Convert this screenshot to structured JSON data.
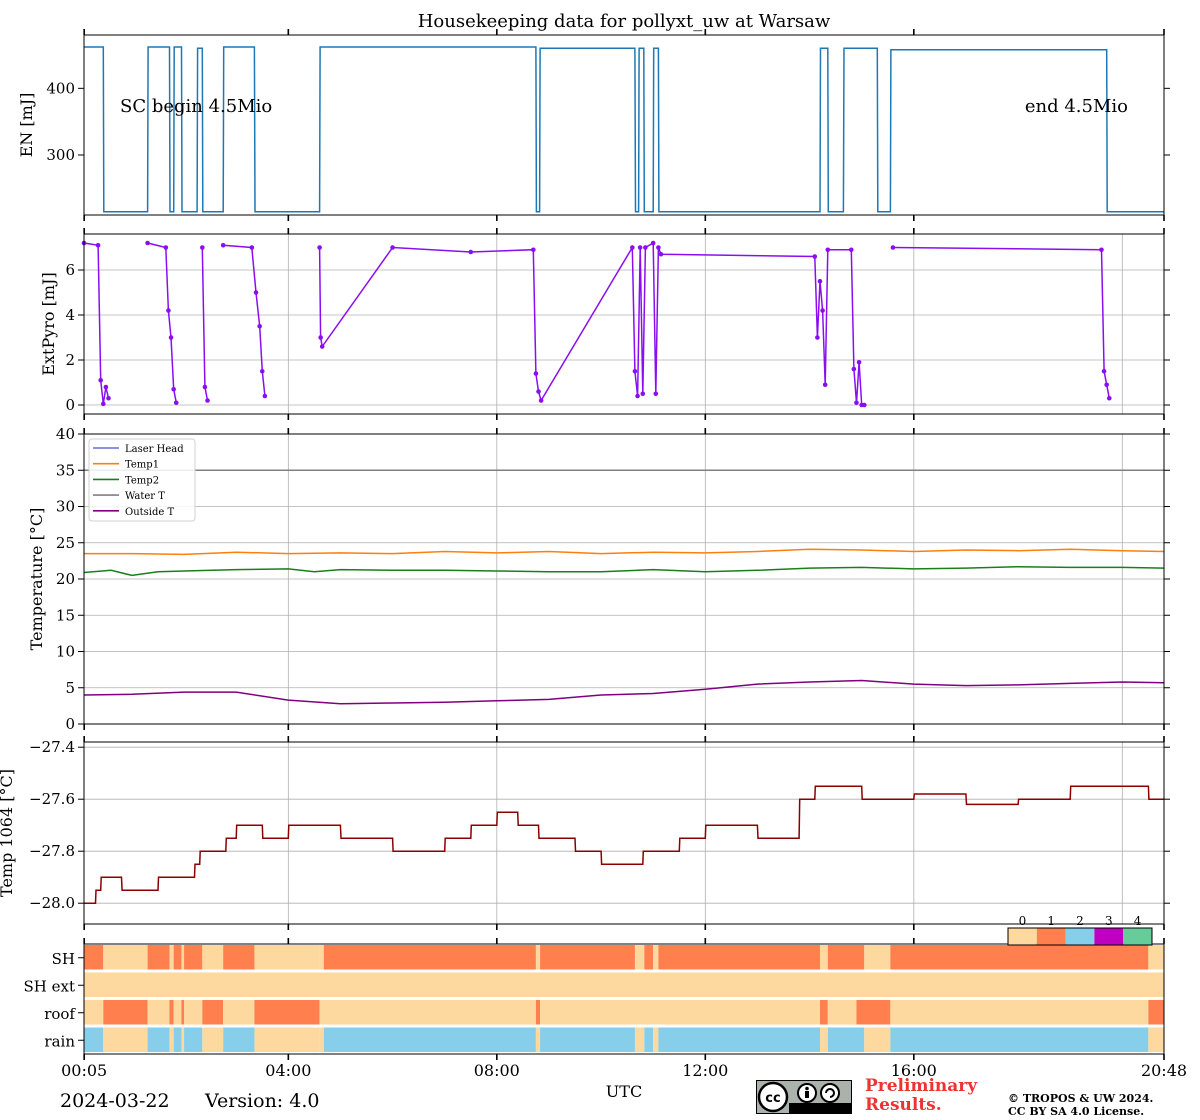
{
  "chart_data": [
    {
      "panel": "EN",
      "type": "line",
      "title": "Housekeeping data for pollyxt_uw at Warsaw",
      "ylabel": "EN [mJ]",
      "ylim": [
        210,
        480
      ],
      "yticks": [
        300,
        400
      ],
      "color": "#1f77b4",
      "annotations": [
        "SC begin 4.5Mio",
        "end 4.5Mio"
      ],
      "series": [
        {
          "x": [
            0.08,
            0.45,
            0.46,
            1.3,
            1.31,
            1.72,
            1.73,
            1.8,
            1.81,
            1.95,
            1.96,
            2.25,
            2.26,
            2.35,
            2.36,
            2.75,
            2.76,
            3.35,
            3.36,
            4.6,
            4.61,
            8.75,
            8.76,
            8.82,
            8.83,
            10.65,
            10.66,
            10.72,
            10.73,
            10.82,
            10.83,
            11.0,
            11.01,
            11.1,
            11.11,
            14.2,
            14.21,
            14.35,
            14.36,
            14.65,
            14.66,
            15.3,
            15.31,
            15.55,
            15.56,
            19.7,
            19.71,
            20.8
          ],
          "y": [
            462,
            462,
            215,
            215,
            462,
            462,
            215,
            215,
            462,
            462,
            215,
            215,
            460,
            460,
            215,
            215,
            462,
            462,
            215,
            215,
            462,
            462,
            215,
            215,
            460,
            460,
            215,
            215,
            460,
            460,
            215,
            215,
            460,
            460,
            215,
            215,
            460,
            460,
            215,
            215,
            460,
            460,
            215,
            215,
            458,
            458,
            215,
            215
          ]
        }
      ]
    },
    {
      "panel": "ExtPyro",
      "type": "line",
      "ylabel": "ExtPyro [mJ]",
      "ylim": [
        -0.4,
        7.6
      ],
      "yticks": [
        0,
        2,
        4,
        6
      ],
      "color": "#8a0ef0",
      "series": [
        {
          "x": [
            0.08,
            0.35,
            0.4,
            0.45,
            0.5,
            0.55,
            0.6,
            null,
            1.3,
            1.65,
            1.7,
            1.75,
            1.8,
            1.85,
            1.9,
            2.35,
            2.4,
            2.45,
            null,
            2.75,
            3.3,
            3.38,
            3.45,
            3.5,
            3.55,
            null,
            4.6,
            4.62,
            4.65,
            6.0,
            7.5,
            8.7,
            8.75,
            8.8,
            8.85,
            10.6,
            10.65,
            10.7,
            10.75,
            10.8,
            10.85,
            11.0,
            11.05,
            11.1,
            11.15,
            14.1,
            14.15,
            14.2,
            14.25,
            14.3,
            14.35,
            14.8,
            14.85,
            14.9,
            14.95,
            15.0,
            15.05,
            null,
            15.6,
            19.6,
            19.65,
            19.7,
            19.75
          ],
          "y": [
            7.2,
            7.1,
            1.1,
            0.05,
            0.8,
            0.3,
            null,
            null,
            7.2,
            7.0,
            4.2,
            3.0,
            0.7,
            0.1,
            null,
            7.0,
            0.8,
            0.2,
            null,
            7.1,
            7.0,
            5.0,
            3.5,
            1.5,
            0.4,
            null,
            7.0,
            3.0,
            2.6,
            7.0,
            6.8,
            6.9,
            1.4,
            0.6,
            0.2,
            7.0,
            1.5,
            0.4,
            7.0,
            0.5,
            7.0,
            7.2,
            0.5,
            7.0,
            6.7,
            6.6,
            3.0,
            5.5,
            4.2,
            0.9,
            6.9,
            6.9,
            1.6,
            0.1,
            1.9,
            0.0,
            0.0,
            null,
            7.0,
            6.9,
            1.5,
            0.9,
            0.3
          ]
        }
      ]
    },
    {
      "panel": "Temperature",
      "type": "line",
      "ylabel": "Temperature [$^\\circ C$]",
      "ylim": [
        0,
        40
      ],
      "yticks": [
        0,
        5,
        10,
        15,
        20,
        25,
        30,
        35,
        40
      ],
      "legend_loc": "upper-left",
      "series": [
        {
          "name": "Laser Head",
          "color": "#6b6bd6",
          "x": [],
          "y": []
        },
        {
          "name": "Temp1",
          "color": "#ff7f0e",
          "x": [
            0.08,
            1.0,
            2.0,
            3.0,
            4.0,
            5.0,
            6.0,
            7.0,
            8.0,
            9.0,
            10.0,
            11.0,
            12.0,
            13.0,
            14.0,
            15.0,
            16.0,
            17.0,
            18.0,
            19.0,
            20.0,
            20.8
          ],
          "y": [
            23.5,
            23.5,
            23.4,
            23.7,
            23.5,
            23.6,
            23.5,
            23.8,
            23.6,
            23.8,
            23.5,
            23.7,
            23.6,
            23.8,
            24.1,
            24.0,
            23.8,
            24.0,
            23.9,
            24.1,
            23.9,
            23.8
          ]
        },
        {
          "name": "Temp2",
          "color": "#1a7f1a",
          "x": [
            0.08,
            0.6,
            1.0,
            1.5,
            2.0,
            3.0,
            4.0,
            4.5,
            5.0,
            6.0,
            7.0,
            8.0,
            9.0,
            10.0,
            11.0,
            12.0,
            13.0,
            14.0,
            15.0,
            16.0,
            17.0,
            18.0,
            19.0,
            20.0,
            20.8
          ],
          "y": [
            20.9,
            21.2,
            20.5,
            21.0,
            21.1,
            21.3,
            21.4,
            21.0,
            21.3,
            21.2,
            21.2,
            21.1,
            21.0,
            21.0,
            21.3,
            21.0,
            21.2,
            21.5,
            21.6,
            21.4,
            21.5,
            21.7,
            21.6,
            21.6,
            21.5
          ]
        },
        {
          "name": "Water T",
          "color": "#808080",
          "x": [
            0.08,
            20.8
          ],
          "y": [
            35.0,
            35.0
          ]
        },
        {
          "name": "Outside T",
          "color": "#800080",
          "x": [
            0.08,
            1.0,
            2.0,
            3.0,
            4.0,
            5.0,
            6.0,
            7.0,
            8.0,
            9.0,
            10.0,
            11.0,
            12.0,
            13.0,
            14.0,
            15.0,
            16.0,
            17.0,
            18.0,
            19.0,
            20.0,
            20.8
          ],
          "y": [
            4.0,
            4.1,
            4.4,
            4.4,
            3.3,
            2.8,
            2.9,
            3.0,
            3.2,
            3.4,
            4.0,
            4.2,
            4.8,
            5.5,
            5.8,
            6.0,
            5.5,
            5.3,
            5.4,
            5.6,
            5.8,
            5.7
          ]
        }
      ]
    },
    {
      "panel": "Temp1064",
      "type": "line",
      "ylabel": "Temp 1064 [$^\\circ C$]",
      "ylim": [
        -28.08,
        -27.38
      ],
      "yticks": [
        -28.0,
        -27.8,
        -27.6,
        -27.4
      ],
      "color": "#8b0000",
      "series": [
        {
          "x": [
            0.08,
            0.3,
            0.31,
            0.4,
            0.41,
            0.8,
            0.81,
            1.5,
            1.51,
            2.2,
            2.21,
            2.3,
            2.31,
            2.8,
            2.81,
            3.0,
            3.01,
            3.5,
            3.51,
            4.0,
            4.01,
            5.0,
            5.01,
            6.0,
            6.01,
            7.0,
            7.01,
            7.5,
            7.51,
            8.0,
            8.01,
            8.4,
            8.41,
            8.8,
            8.81,
            9.5,
            9.51,
            10.0,
            10.01,
            10.8,
            10.81,
            11.5,
            11.51,
            12.0,
            12.01,
            13.0,
            13.01,
            13.8,
            13.81,
            14.1,
            14.11,
            15.0,
            15.01,
            16.0,
            16.01,
            17.0,
            17.01,
            18.0,
            18.01,
            19.0,
            19.01,
            20.5,
            20.51,
            20.8
          ],
          "y": [
            -28.0,
            -28.0,
            -27.95,
            -27.95,
            -27.9,
            -27.9,
            -27.95,
            -27.95,
            -27.9,
            -27.9,
            -27.85,
            -27.85,
            -27.8,
            -27.8,
            -27.75,
            -27.75,
            -27.7,
            -27.7,
            -27.75,
            -27.75,
            -27.7,
            -27.7,
            -27.75,
            -27.75,
            -27.8,
            -27.8,
            -27.75,
            -27.75,
            -27.7,
            -27.7,
            -27.65,
            -27.65,
            -27.7,
            -27.7,
            -27.75,
            -27.75,
            -27.8,
            -27.8,
            -27.85,
            -27.85,
            -27.8,
            -27.8,
            -27.75,
            -27.75,
            -27.7,
            -27.7,
            -27.75,
            -27.75,
            -27.6,
            -27.6,
            -27.55,
            -27.55,
            -27.6,
            -27.6,
            -27.58,
            -27.58,
            -27.62,
            -27.62,
            -27.6,
            -27.6,
            -27.55,
            -27.55,
            -27.6,
            -27.6
          ]
        }
      ]
    },
    {
      "panel": "Status",
      "type": "heatmap",
      "rows": [
        "SH",
        "SH ext",
        "roof",
        "rain"
      ],
      "color_scale": {
        "labels": [
          "0",
          "1",
          "2",
          "3",
          "4"
        ],
        "colors": [
          "#fdd9a0",
          "#ff7f4f",
          "#87ceeb",
          "#c000c0",
          "#66cc99"
        ]
      },
      "segments": {
        "SH": [
          [
            0.08,
            0.45,
            1
          ],
          [
            0.45,
            1.3,
            0
          ],
          [
            1.3,
            1.72,
            1
          ],
          [
            1.72,
            1.8,
            0
          ],
          [
            1.8,
            1.95,
            1
          ],
          [
            1.95,
            2.0,
            0
          ],
          [
            2.0,
            2.35,
            1
          ],
          [
            2.35,
            2.75,
            0
          ],
          [
            2.75,
            3.35,
            1
          ],
          [
            3.35,
            4.6,
            0
          ],
          [
            4.6,
            4.68,
            0
          ],
          [
            4.68,
            8.75,
            1
          ],
          [
            8.75,
            8.83,
            0
          ],
          [
            8.83,
            10.65,
            1
          ],
          [
            10.65,
            10.83,
            0
          ],
          [
            10.83,
            11.0,
            1
          ],
          [
            11.0,
            11.1,
            0
          ],
          [
            11.1,
            14.2,
            1
          ],
          [
            14.2,
            14.35,
            0
          ],
          [
            14.35,
            15.05,
            1
          ],
          [
            15.05,
            15.55,
            0
          ],
          [
            15.55,
            20.5,
            1
          ],
          [
            20.5,
            20.8,
            0
          ]
        ],
        "SH ext": [
          [
            0.08,
            20.8,
            0
          ]
        ],
        "roof": [
          [
            0.08,
            0.45,
            0
          ],
          [
            0.45,
            1.3,
            1
          ],
          [
            1.3,
            1.72,
            0
          ],
          [
            1.72,
            1.8,
            1
          ],
          [
            1.8,
            1.95,
            0
          ],
          [
            1.95,
            2.0,
            1
          ],
          [
            2.0,
            2.35,
            0
          ],
          [
            2.35,
            2.75,
            1
          ],
          [
            2.75,
            3.35,
            0
          ],
          [
            3.35,
            4.6,
            1
          ],
          [
            4.6,
            8.75,
            0
          ],
          [
            8.75,
            8.83,
            1
          ],
          [
            8.83,
            14.2,
            0
          ],
          [
            14.2,
            14.35,
            1
          ],
          [
            14.35,
            14.9,
            0
          ],
          [
            14.9,
            15.55,
            1
          ],
          [
            15.55,
            20.5,
            0
          ],
          [
            20.5,
            20.8,
            1
          ]
        ],
        "rain": [
          [
            0.08,
            0.45,
            2
          ],
          [
            0.45,
            1.3,
            0
          ],
          [
            1.3,
            1.72,
            2
          ],
          [
            1.72,
            1.8,
            0
          ],
          [
            1.8,
            1.95,
            2
          ],
          [
            1.95,
            2.0,
            0
          ],
          [
            2.0,
            2.35,
            2
          ],
          [
            2.35,
            2.75,
            0
          ],
          [
            2.75,
            3.35,
            2
          ],
          [
            3.35,
            4.6,
            0
          ],
          [
            4.6,
            4.68,
            0
          ],
          [
            4.68,
            8.75,
            2
          ],
          [
            8.75,
            8.83,
            0
          ],
          [
            8.83,
            10.65,
            2
          ],
          [
            10.65,
            10.83,
            0
          ],
          [
            10.83,
            11.0,
            2
          ],
          [
            11.0,
            11.1,
            0
          ],
          [
            11.1,
            14.2,
            2
          ],
          [
            14.2,
            14.35,
            0
          ],
          [
            14.35,
            15.05,
            2
          ],
          [
            15.05,
            15.55,
            0
          ],
          [
            15.55,
            20.5,
            2
          ],
          [
            20.5,
            20.8,
            0
          ]
        ]
      }
    }
  ],
  "x_axis": {
    "label": "UTC",
    "range": [
      0.08,
      20.8
    ],
    "ticks": [
      {
        "v": 0.0833,
        "label": "00:05"
      },
      {
        "v": 4,
        "label": "04:00"
      },
      {
        "v": 8,
        "label": "08:00"
      },
      {
        "v": 12,
        "label": "12:00"
      },
      {
        "v": 16,
        "label": "16:00"
      },
      {
        "v": 20.8,
        "label": "20:48"
      }
    ],
    "grid": [
      4,
      8,
      12,
      16,
      20
    ]
  },
  "footer": {
    "date": "2024-03-22",
    "version": "Version: 4.0",
    "prelim_line1": "Preliminary",
    "prelim_line2": "Results.",
    "copyright_line1": "© TROPOS & UW 2024.",
    "copyright_line2": "CC BY SA 4.0 License.",
    "cc_badge": "cc-by-sa-icon"
  }
}
